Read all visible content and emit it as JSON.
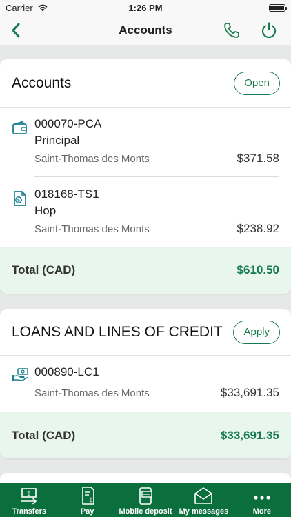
{
  "status_bar": {
    "carrier": "Carrier",
    "time": "1:26 PM"
  },
  "nav": {
    "title": "Accounts",
    "icons": [
      "chevron-left-icon",
      "phone-icon",
      "power-icon"
    ]
  },
  "accounts_card": {
    "title": "Accounts",
    "action_label": "Open",
    "rows": [
      {
        "icon": "wallet-icon",
        "number": "000070-PCA",
        "name": "Principal",
        "branch": "Saint-Thomas des Monts",
        "balance": "$371.58"
      },
      {
        "icon": "savings-document-icon",
        "number": "018168-TS1",
        "name": "Hop",
        "branch": "Saint-Thomas des Monts",
        "balance": "$238.92"
      }
    ],
    "total_label": "Total (CAD)",
    "total_value": "$610.50"
  },
  "loans_card": {
    "title": "LOANS AND LINES OF CREDIT",
    "action_label": "Apply",
    "rows": [
      {
        "icon": "cash-hand-icon",
        "number": "000890-LC1",
        "branch": "Saint-Thomas des Monts",
        "balance": "$33,691.35"
      }
    ],
    "total_label": "Total (CAD)",
    "total_value": "$33,691.35"
  },
  "tab_bar": {
    "tabs": [
      {
        "label": "Transfers",
        "icon": "transfer-icon"
      },
      {
        "label": "Pay",
        "icon": "bill-icon"
      },
      {
        "label": "Mobile deposit",
        "icon": "mobile-deposit-icon"
      },
      {
        "label": "My messages",
        "icon": "envelope-icon"
      },
      {
        "label": "More",
        "icon": "more-dots-icon"
      }
    ]
  },
  "colors": {
    "brand_green": "#157a4c",
    "tab_bar": "#0a6f3c",
    "total_row_bg": "#e9f6ee",
    "icon_teal": "#1a7f8c"
  }
}
